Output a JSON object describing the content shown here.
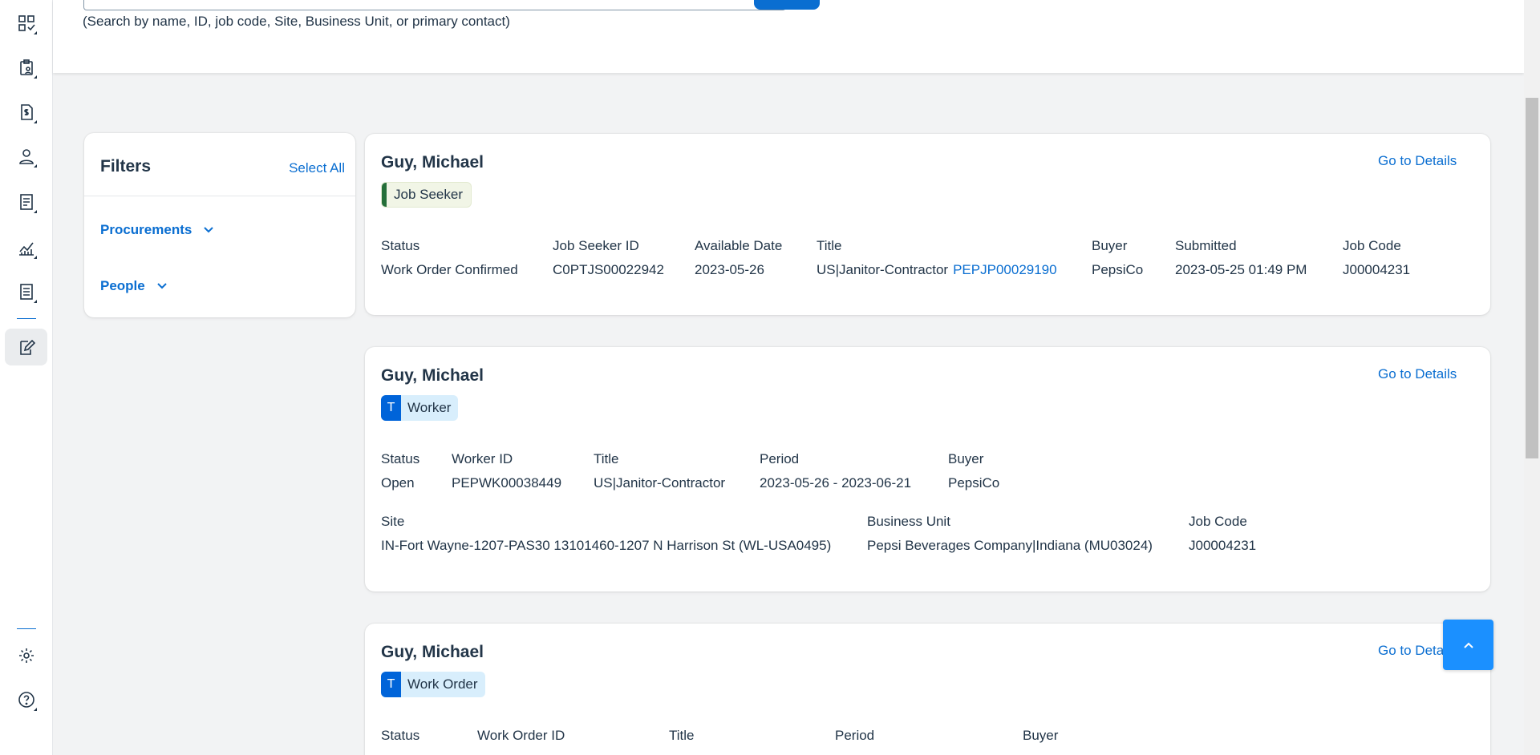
{
  "search": {
    "hint": "(Search by name, ID, job code, Site, Business Unit, or primary contact)"
  },
  "nav": {
    "items": [
      {
        "icon": "qr-check-icon"
      },
      {
        "icon": "clipboard-person-icon"
      },
      {
        "icon": "invoice-dollar-icon"
      },
      {
        "icon": "person-icon"
      },
      {
        "icon": "receipt-icon"
      },
      {
        "icon": "analytics-chart-icon"
      },
      {
        "icon": "document-list-icon"
      },
      {
        "icon": "edit-document-icon"
      }
    ],
    "settings_icon": "gear-icon",
    "help_icon": "help-circle-icon"
  },
  "filters": {
    "title": "Filters",
    "select_all": "Select All",
    "groups": [
      {
        "label": "Procurements"
      },
      {
        "label": "People"
      }
    ]
  },
  "results": [
    {
      "name": "Guy, Michael",
      "go_details": "Go to Details",
      "tag": "Job Seeker",
      "fields": {
        "status": {
          "label": "Status",
          "value": "Work Order Confirmed"
        },
        "job_seeker_id": {
          "label": "Job Seeker ID",
          "value": "C0PTJS00022942"
        },
        "available_date": {
          "label": "Available Date",
          "value": "2023-05-26"
        },
        "title": {
          "label": "Title",
          "value": "US|Janitor-Contractor",
          "link": "PEPJP00029190"
        },
        "buyer": {
          "label": "Buyer",
          "value": "PepsiCo"
        },
        "submitted": {
          "label": "Submitted",
          "value": "2023-05-25 01:49 PM"
        },
        "job_code": {
          "label": "Job Code",
          "value": "J00004231"
        }
      }
    },
    {
      "name": "Guy, Michael",
      "go_details": "Go to Details",
      "tag_letter": "T",
      "tag": "Worker",
      "fields": {
        "status": {
          "label": "Status",
          "value": "Open"
        },
        "worker_id": {
          "label": "Worker ID",
          "value": "PEPWK00038449"
        },
        "title": {
          "label": "Title",
          "value": "US|Janitor-Contractor"
        },
        "period": {
          "label": "Period",
          "value": "2023-05-26 - 2023-06-21"
        },
        "buyer": {
          "label": "Buyer",
          "value": "PepsiCo"
        },
        "site": {
          "label": "Site",
          "value": "IN-Fort Wayne-1207-PAS30 13101460-1207 N Harrison St (WL-USA0495)"
        },
        "business_unit": {
          "label": "Business Unit",
          "value": "Pepsi Beverages Company|Indiana (MU03024)"
        },
        "job_code": {
          "label": "Job Code",
          "value": "J00004231"
        }
      }
    },
    {
      "name": "Guy, Michael",
      "go_details": "Go to Details",
      "tag_letter": "T",
      "tag": "Work Order",
      "fields": {
        "status": {
          "label": "Status"
        },
        "work_order_id": {
          "label": "Work Order ID"
        },
        "title": {
          "label": "Title"
        },
        "period": {
          "label": "Period"
        },
        "buyer": {
          "label": "Buyer"
        }
      }
    }
  ],
  "colors": {
    "accent": "#0a6ed1",
    "text": "#223548",
    "seeker_stripe": "#256f3a",
    "tag_blue": "#0064d9",
    "up_button": "#1b90ff"
  }
}
